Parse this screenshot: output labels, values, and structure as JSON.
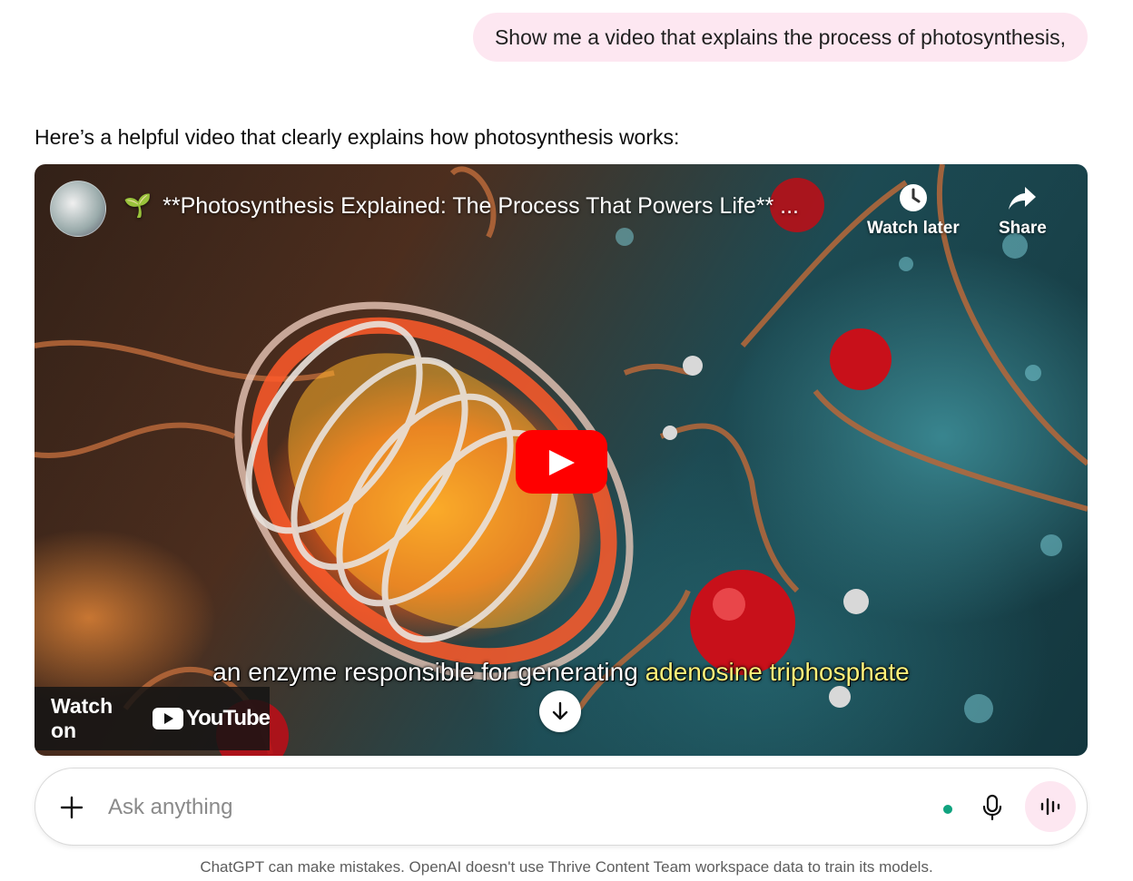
{
  "conversation": {
    "user_message": "Show me a video that explains the process of photosynthesis,",
    "assistant_intro": "Here’s a helpful video that clearly explains how photosynthesis works:"
  },
  "video": {
    "title_emoji": "🌱",
    "title": "**Photosynthesis Explained: The Process That Powers Life** ...",
    "watch_later_label": "Watch later",
    "share_label": "Share",
    "subtitle_plain": "an enzyme responsible for generating",
    "subtitle_highlight": "adenosine triphosphate",
    "watch_on_label": "Watch on",
    "youtube_label": "YouTube",
    "icons": {
      "avatar": "channel-avatar",
      "watch_later": "clock-icon",
      "share": "share-arrow-icon",
      "play": "play-icon",
      "scroll": "arrow-down-icon"
    }
  },
  "composer": {
    "placeholder": "Ask anything",
    "value": "",
    "icons": {
      "add": "plus-icon",
      "mic": "microphone-icon",
      "voice": "voice-mode-icon"
    }
  },
  "footer": {
    "disclaimer": "ChatGPT can make mistakes. OpenAI doesn't use Thrive Content Team workspace data to train its models."
  },
  "colors": {
    "user_bubble": "#fde7f1",
    "play_red": "#ff0000",
    "subtitle_highlight": "#fff27a",
    "status_dot": "#10a37f"
  }
}
